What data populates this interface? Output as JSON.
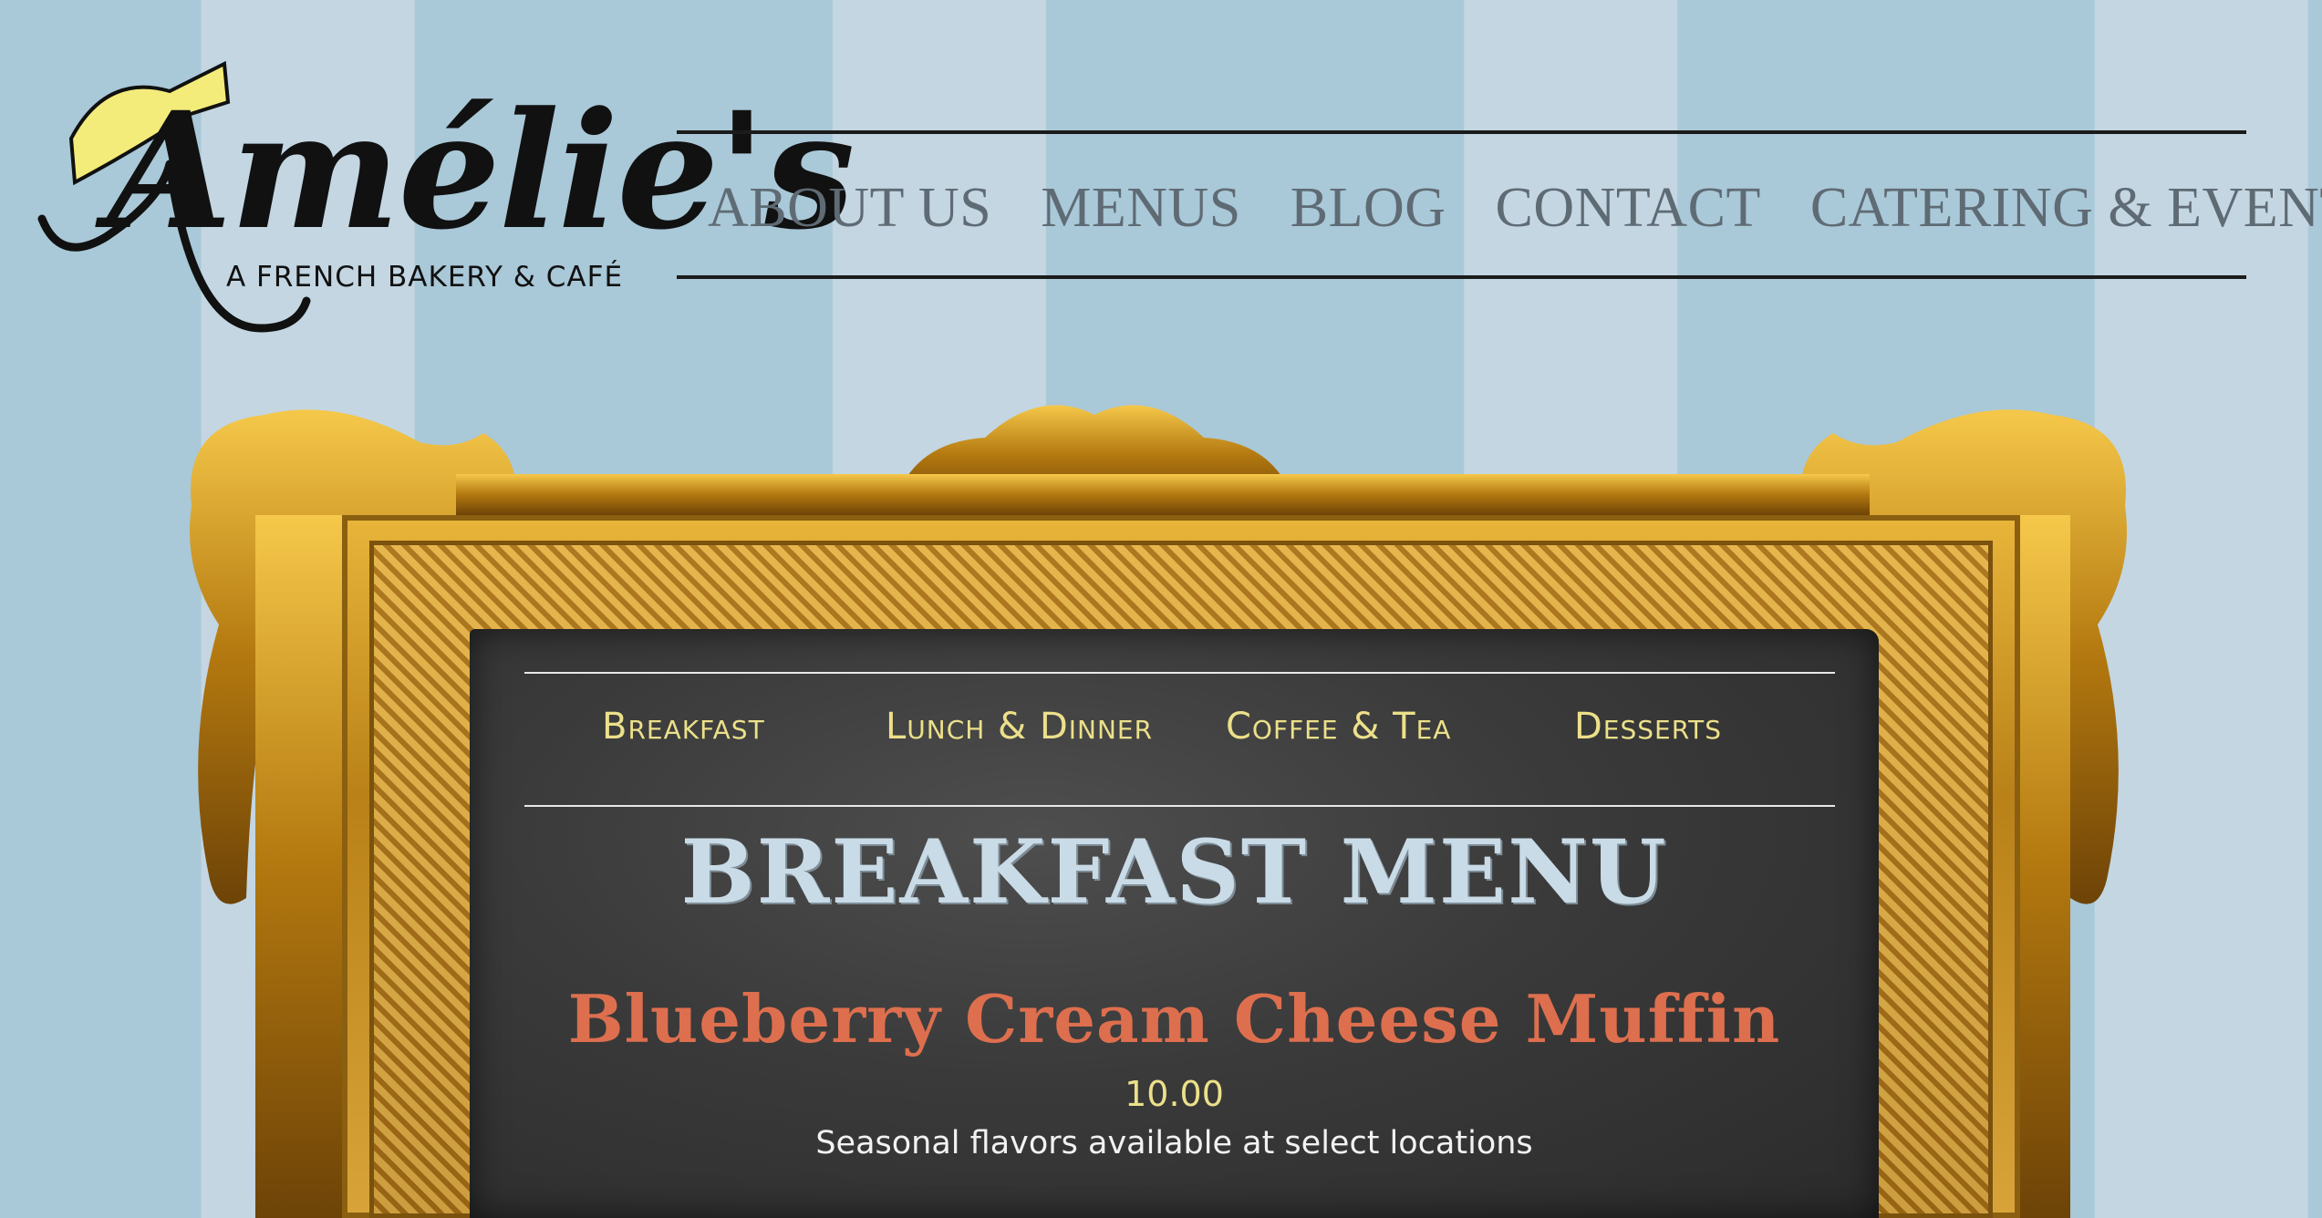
{
  "logo": {
    "wordmark": "Amélie's",
    "tagline": "A FRENCH BAKERY & CAFÉ",
    "hat_color": "#f4ec7a"
  },
  "nav": {
    "items": [
      {
        "label": "ABOUT US"
      },
      {
        "label": "MENUS"
      },
      {
        "label": "BLOG"
      },
      {
        "label": "CONTACT"
      },
      {
        "label": "CATERING & EVENTS"
      }
    ]
  },
  "menu_tabs": [
    {
      "label": "Breakfast"
    },
    {
      "label": "Lunch & Dinner"
    },
    {
      "label": "Coffee & Tea"
    },
    {
      "label": "Desserts"
    }
  ],
  "menu": {
    "title": "BREAKFAST MENU",
    "item": {
      "name": "Blueberry Cream Cheese Muffin",
      "price": "10.00",
      "description": "Seasonal flavors available at select locations"
    }
  },
  "colors": {
    "stripe_dark": "#a9c8d8",
    "stripe_light": "#c3d6e2",
    "nav_text": "#5f6b74",
    "chalk_yellow": "#ece08a",
    "chalk_blue": "#c9dbe6",
    "chalk_red": "#dd6f4e",
    "gold": "#d9a232"
  }
}
